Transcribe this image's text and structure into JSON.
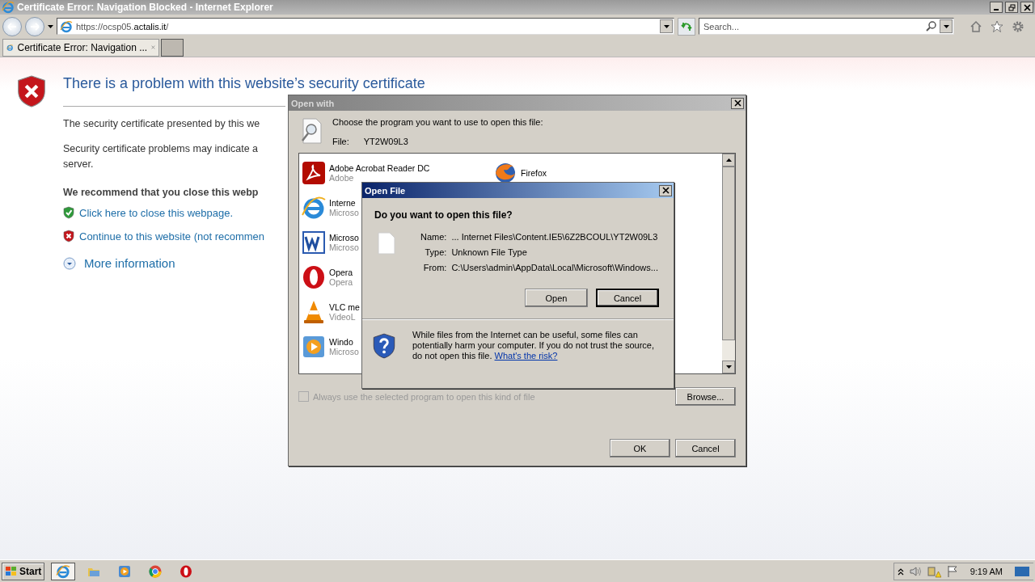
{
  "window": {
    "title": "Certificate Error: Navigation Blocked - Internet Explorer"
  },
  "address_bar": {
    "url_prefix": "https://ocsp05.",
    "url_domain": "actalis.it",
    "url_suffix": "/"
  },
  "search": {
    "placeholder": "Search..."
  },
  "tabs": [
    {
      "label": "Certificate Error: Navigation ...",
      "selected": true
    }
  ],
  "page": {
    "heading": "There is a problem with this website’s security certificate",
    "paragraphs": [
      {
        "lines": [
          "The security certificate presented by this we"
        ]
      },
      {
        "lines": [
          "Security certificate problems may indicate a",
          "server."
        ]
      }
    ],
    "recommendation": "We recommend that you close this webp",
    "links": [
      {
        "kind": "safe",
        "text": "Click here to close this webpage."
      },
      {
        "kind": "unsafe",
        "text": "Continue to this website (not recommen"
      }
    ],
    "more_info": "More information"
  },
  "open_with": {
    "title": "Open with",
    "prompt": "Choose the program you want to use to open this file:",
    "file_label": "File:",
    "file_name": "YT2W09L3",
    "programs": [
      {
        "kind": "pdf",
        "name": "Adobe Acrobat Reader DC",
        "publisher": "Adobe"
      },
      {
        "kind": "ie",
        "name": "Interne",
        "publisher": "Microso"
      },
      {
        "kind": "word",
        "name": "Microso",
        "publisher": "Microso"
      },
      {
        "kind": "opera",
        "name": "Opera",
        "publisher": "Opera"
      },
      {
        "kind": "vlc",
        "name": "VLC me",
        "publisher": "VideoL"
      },
      {
        "kind": "wmp",
        "name": "Windo",
        "publisher": "Microso"
      },
      {
        "kind": "firefox",
        "name": "Firefox"
      }
    ],
    "checkbox": {
      "label": "Always use the selected program to open this kind of file",
      "checked": false,
      "disabled": true
    },
    "browse": "Browse...",
    "ok": "OK",
    "cancel": "Cancel"
  },
  "open_file": {
    "title": "Open File",
    "question": "Do you want to open this file?",
    "fields": [
      {
        "label": "Name:",
        "value": "... Internet Files\\Content.IE5\\6Z2BCOUL\\YT2W09L3"
      },
      {
        "label": "Type:",
        "value": "Unknown File Type"
      },
      {
        "label": "From:",
        "value": "C:\\Users\\admin\\AppData\\Local\\Microsoft\\Windows..."
      }
    ],
    "buttons": [
      {
        "label": "Open",
        "default": false
      },
      {
        "label": "Cancel",
        "default": true
      }
    ],
    "warning": "While files from the Internet can be useful, some files can potentially harm your computer. If you do not trust the source, do not open this file.",
    "risk_link": "What's the risk?"
  },
  "taskbar": {
    "start": "Start",
    "apps": [
      {
        "kind": "ie",
        "active": true
      },
      {
        "kind": "folder",
        "active": false
      },
      {
        "kind": "wmp",
        "active": false
      },
      {
        "kind": "chrome",
        "active": false
      },
      {
        "kind": "opera",
        "active": false
      }
    ],
    "clock": "9:19 AM"
  }
}
